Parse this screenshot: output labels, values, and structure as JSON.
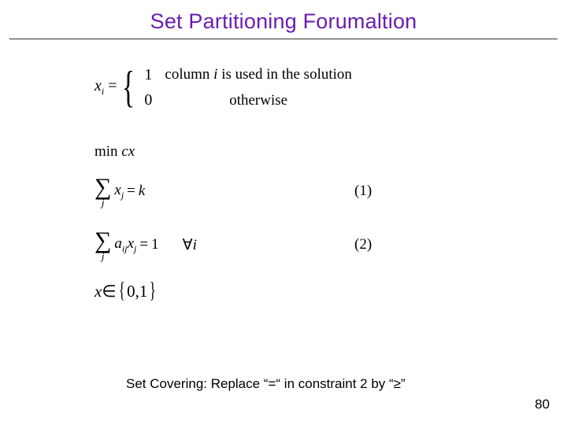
{
  "title": "Set Partitioning Forumaltion",
  "def": {
    "lhs_var": "x",
    "lhs_sub": "i",
    "eq": " = ",
    "case1_val": "1",
    "case1_cond_pre": "column ",
    "case1_cond_var": "i",
    "case1_cond_post": " is used in the solution",
    "case0_val": "0",
    "case0_cond": "otherwise"
  },
  "objective": {
    "min": "min",
    "cx": " cx"
  },
  "c1": {
    "sum_index": "j",
    "term_var": "x",
    "term_sub": "j",
    "eq": " = ",
    "rhs": "k",
    "num": "(1)"
  },
  "c2": {
    "sum_index": "j",
    "coef_var": "a",
    "coef_sub": "ij",
    "term_var": "x",
    "term_sub": "j",
    "eq": " = ",
    "rhs": "1",
    "forall": "∀",
    "forall_var": "i",
    "num": "(2)"
  },
  "domain": {
    "x": "x",
    "in": " ∈ ",
    "set": "0,1"
  },
  "footnote": "Set Covering: Replace “=“ in constraint 2 by “≥”",
  "pagenum": "80"
}
